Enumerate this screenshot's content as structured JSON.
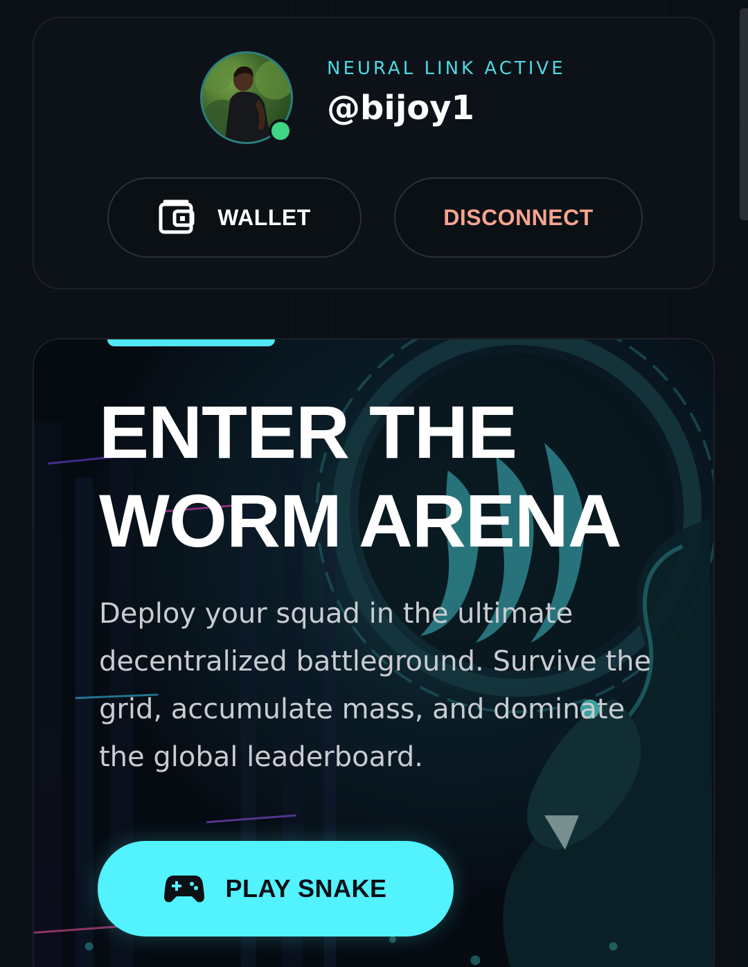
{
  "profile": {
    "status": "NEURAL LINK ACTIVE",
    "username": "@bijoy1",
    "avatar_icon": "user-avatar",
    "online_indicator_color": "#3fd486",
    "wallet_button": {
      "label": "WALLET",
      "icon": "wallet-icon"
    },
    "disconnect_button": {
      "label": "DISCONNECT",
      "color": "#f6a48f"
    }
  },
  "hero": {
    "title_line1": "ENTER THE",
    "title_line2": "WORM ARENA",
    "description": "Deploy your squad in the ultimate decentralized battleground. Survive the grid, accumulate mass, and dominate the global leaderboard.",
    "play_button": {
      "label": "PLAY SNAKE",
      "icon": "gamepad-icon"
    },
    "accent_color": "#52f2ff"
  }
}
